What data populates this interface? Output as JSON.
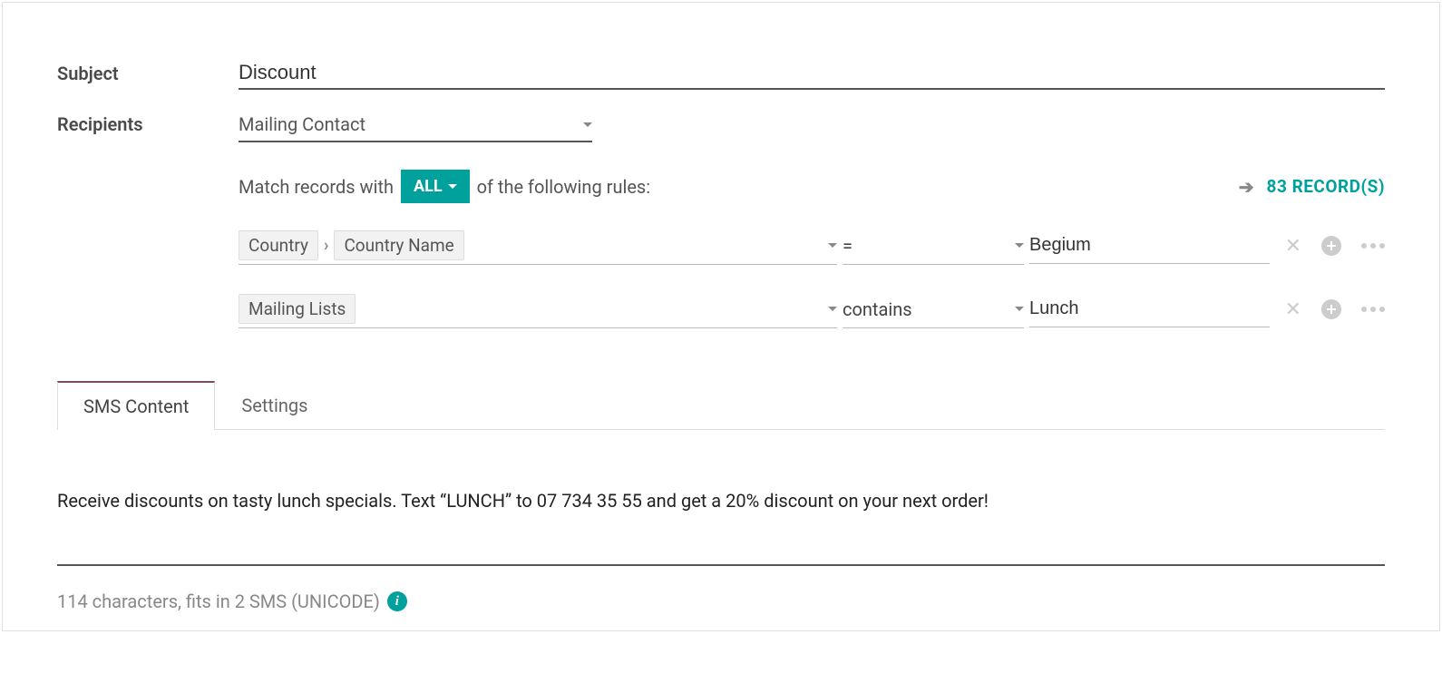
{
  "form": {
    "subject_label": "Subject",
    "subject_value": "Discount",
    "recipients_label": "Recipients",
    "recipients_value": "Mailing Contact"
  },
  "match": {
    "pre_text": "Match records with",
    "badge": "ALL",
    "post_text": "of the following rules:",
    "records_count": "83 RECORD(S)"
  },
  "rules": [
    {
      "field_parts": [
        "Country",
        "Country Name"
      ],
      "operator": "=",
      "value": "Begium"
    },
    {
      "field_parts": [
        "Mailing Lists"
      ],
      "operator": "contains",
      "value": "Lunch"
    }
  ],
  "tabs": [
    {
      "label": "SMS Content",
      "active": true
    },
    {
      "label": "Settings",
      "active": false
    }
  ],
  "sms": {
    "content": "Receive discounts on tasty lunch specials. Text “LUNCH” to 07 734 35 55 and get a 20% discount on your next order!",
    "char_info": "114 characters, fits in 2 SMS (UNICODE)"
  }
}
